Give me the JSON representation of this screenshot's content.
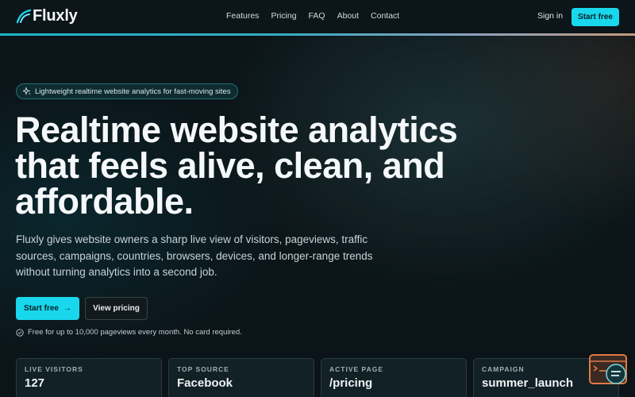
{
  "brand": {
    "name": "Fluxly",
    "accent": "#19d7ec"
  },
  "nav": {
    "items": [
      {
        "label": "Features"
      },
      {
        "label": "Pricing"
      },
      {
        "label": "FAQ"
      },
      {
        "label": "About"
      },
      {
        "label": "Contact"
      }
    ],
    "signin": "Sign in",
    "cta": "Start free"
  },
  "hero": {
    "badge": "Lightweight realtime website analytics for fast-moving sites",
    "badge_icon": "sparkle-icon",
    "title_lines": [
      "Realtime website analytics",
      "that feels alive, clean, and",
      "affordable."
    ],
    "subtitle": "Fluxly gives website owners a sharp live view of visitors, pageviews, traffic sources, campaigns, countries, browsers, devices, and longer-range trends without turning analytics into a second job.",
    "primary_cta": "Start free",
    "primary_cta_icon": "arrow-right-icon",
    "secondary_cta": "View pricing",
    "note": "Free for up to 10,000 pageviews every month. No card required.",
    "note_icon": "check-circle-icon"
  },
  "stats": [
    {
      "label": "LIVE VISITORS",
      "value": "127"
    },
    {
      "label": "TOP SOURCE",
      "value": "Facebook"
    },
    {
      "label": "ACTIVE PAGE",
      "value": "/pricing"
    },
    {
      "label": "CAMPAIGN",
      "value": "summer_launch"
    }
  ]
}
